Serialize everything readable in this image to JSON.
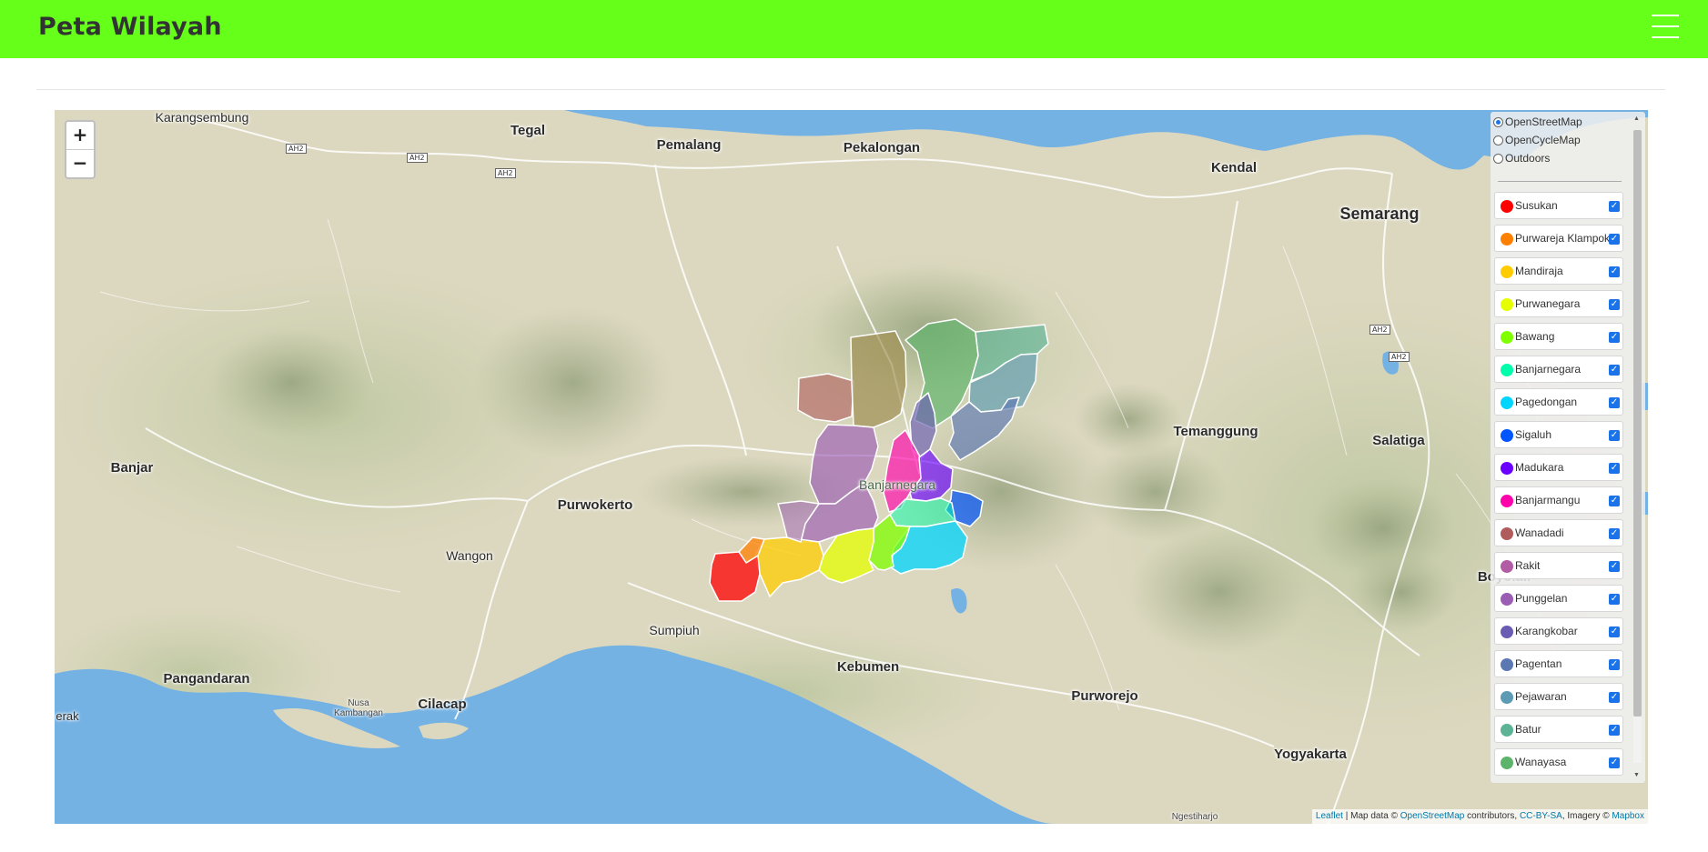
{
  "navbar": {
    "brand": "Peta Wilayah",
    "menu_icon": "hamburger-icon"
  },
  "map": {
    "zoom_in": "+",
    "zoom_out": "−",
    "base_layers": [
      {
        "label": "OpenStreetMap",
        "selected": true
      },
      {
        "label": "OpenCycleMap",
        "selected": false
      },
      {
        "label": "Outdoors",
        "selected": false
      }
    ],
    "overlays": [
      {
        "label": "Susukan",
        "color": "#ff0000",
        "checked": true
      },
      {
        "label": "Purwareja Klampok",
        "color": "#ff8000",
        "checked": true
      },
      {
        "label": "Mandiraja",
        "color": "#ffcc00",
        "checked": true
      },
      {
        "label": "Purwanegara",
        "color": "#e5ff00",
        "checked": true
      },
      {
        "label": "Bawang",
        "color": "#80ff00",
        "checked": true
      },
      {
        "label": "Banjarnegara",
        "color": "#00ffaa",
        "checked": true
      },
      {
        "label": "Pagedongan",
        "color": "#00d5ff",
        "checked": true
      },
      {
        "label": "Sigaluh",
        "color": "#0055ff",
        "checked": true
      },
      {
        "label": "Madukara",
        "color": "#6a00ff",
        "checked": true
      },
      {
        "label": "Banjarmangu",
        "color": "#ff00aa",
        "checked": true
      },
      {
        "label": "Wanadadi",
        "color": "#b05c5c",
        "checked": true
      },
      {
        "label": "Rakit",
        "color": "#b35ca6",
        "checked": true
      },
      {
        "label": "Punggelan",
        "color": "#9b5cb3",
        "checked": true
      },
      {
        "label": "Karangkobar",
        "color": "#6a5cb3",
        "checked": true
      },
      {
        "label": "Pagentan",
        "color": "#5c78b3",
        "checked": true
      },
      {
        "label": "Pejawaran",
        "color": "#5c9bb3",
        "checked": true
      },
      {
        "label": "Batur",
        "color": "#5cb396",
        "checked": true
      },
      {
        "label": "Wanayasa",
        "color": "#5cb36a",
        "checked": true
      }
    ],
    "attribution": {
      "leaflet": "Leaflet",
      "map_data": "Map data ©",
      "osm": "OpenStreetMap",
      "contributors": "contributors,",
      "license": "CC-BY-SA",
      "imagery": ", Imagery ©",
      "mapbox": "Mapbox"
    },
    "place_labels": {
      "karangsembung": "Karangsembung",
      "tegal": "Tegal",
      "pemalang": "Pemalang",
      "pekalongan": "Pekalongan",
      "kendal": "Kendal",
      "semarang": "Semarang",
      "banjar": "Banjar",
      "purwokerto": "Purwokerto",
      "wangon": "Wangon",
      "temanggung": "Temanggung",
      "salatiga": "Salatiga",
      "banjarnegara": "Banjarnegara",
      "sumpiuh": "Sumpiuh",
      "kebumen": "Kebumen",
      "purworejo": "Purworejo",
      "pangandaran": "Pangandaran",
      "cilacap": "Cilacap",
      "nusa_kambangan_1": "Nusa",
      "nusa_kambangan_2": "Kambangan",
      "yogyakarta": "Yogyakarta",
      "boyolali": "Boyolali",
      "ngestiharjo": "Ngestiharjo",
      "kerak": "erak"
    },
    "road_labels": {
      "ah2": "AH2"
    }
  }
}
